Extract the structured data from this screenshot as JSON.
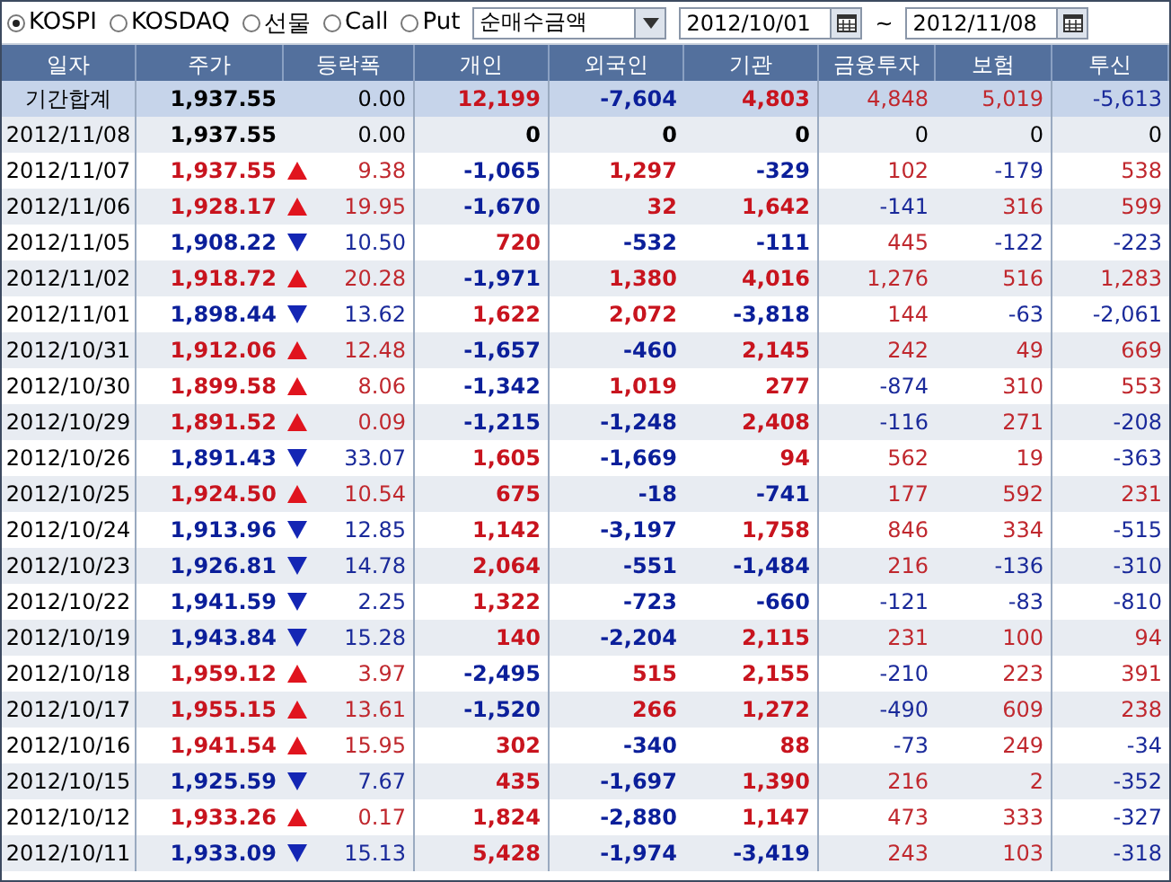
{
  "toolbar": {
    "markets": [
      {
        "label": "KOSPI",
        "selected": true
      },
      {
        "label": "KOSDAQ",
        "selected": false
      },
      {
        "label": "선물",
        "selected": false
      },
      {
        "label": "Call",
        "selected": false
      },
      {
        "label": "Put",
        "selected": false
      }
    ],
    "measure": {
      "value": "순매수금액"
    },
    "date_from": "2012/10/01",
    "range_separator": "~",
    "date_to": "2012/11/08"
  },
  "table": {
    "columns": [
      "일자",
      "주가",
      "등락폭",
      "개인",
      "외국인",
      "기관",
      "금융투자",
      "보험",
      "투신"
    ],
    "rows": [
      {
        "kind": "total",
        "rising": false,
        "falling": false,
        "cells": [
          {
            "text": "기간합계"
          },
          {
            "text": "1,937.55"
          },
          {
            "text": "0.00"
          },
          {
            "text": "12,199",
            "color": "#c8141e"
          },
          {
            "text": "-7,604",
            "color": "#0b1f9a"
          },
          {
            "text": "4,803",
            "color": "#c8141e"
          },
          {
            "text": "4,848",
            "color": "#c0282e"
          },
          {
            "text": "5,019",
            "color": "#c0282e"
          },
          {
            "text": "-5,613",
            "color": "#1a2a9a"
          }
        ]
      },
      {
        "kind": "day",
        "rising": false,
        "falling": false,
        "cells": [
          {
            "text": "2012/11/08"
          },
          {
            "text": "1,937.55"
          },
          {
            "text": "0.00"
          },
          {
            "text": "0"
          },
          {
            "text": "0"
          },
          {
            "text": "0"
          },
          {
            "text": "0"
          },
          {
            "text": "0"
          },
          {
            "text": "0"
          }
        ]
      },
      {
        "kind": "day",
        "rising": true,
        "falling": false,
        "cells": [
          {
            "text": "2012/11/07"
          },
          {
            "text": "1,937.55",
            "color": "#c8141e"
          },
          {
            "text": "9.38",
            "color": "#c0282e"
          },
          {
            "text": "-1,065",
            "color": "#0b1f9a"
          },
          {
            "text": "1,297",
            "color": "#c8141e"
          },
          {
            "text": "-329",
            "color": "#0b1f9a"
          },
          {
            "text": "102",
            "color": "#c0282e"
          },
          {
            "text": "-179",
            "color": "#1a2a9a"
          },
          {
            "text": "538",
            "color": "#c0282e"
          }
        ]
      },
      {
        "kind": "day",
        "rising": true,
        "falling": false,
        "cells": [
          {
            "text": "2012/11/06"
          },
          {
            "text": "1,928.17",
            "color": "#c8141e"
          },
          {
            "text": "19.95",
            "color": "#c0282e"
          },
          {
            "text": "-1,670",
            "color": "#0b1f9a"
          },
          {
            "text": "32",
            "color": "#c8141e"
          },
          {
            "text": "1,642",
            "color": "#c8141e"
          },
          {
            "text": "-141",
            "color": "#1a2a9a"
          },
          {
            "text": "316",
            "color": "#c0282e"
          },
          {
            "text": "599",
            "color": "#c0282e"
          }
        ]
      },
      {
        "kind": "day",
        "rising": false,
        "falling": true,
        "cells": [
          {
            "text": "2012/11/05"
          },
          {
            "text": "1,908.22",
            "color": "#0b1f9a"
          },
          {
            "text": "10.50",
            "color": "#1a2a9a"
          },
          {
            "text": "720",
            "color": "#c8141e"
          },
          {
            "text": "-532",
            "color": "#0b1f9a"
          },
          {
            "text": "-111",
            "color": "#0b1f9a"
          },
          {
            "text": "445",
            "color": "#c0282e"
          },
          {
            "text": "-122",
            "color": "#1a2a9a"
          },
          {
            "text": "-223",
            "color": "#1a2a9a"
          }
        ]
      },
      {
        "kind": "day",
        "rising": true,
        "falling": false,
        "cells": [
          {
            "text": "2012/11/02"
          },
          {
            "text": "1,918.72",
            "color": "#c8141e"
          },
          {
            "text": "20.28",
            "color": "#c0282e"
          },
          {
            "text": "-1,971",
            "color": "#0b1f9a"
          },
          {
            "text": "1,380",
            "color": "#c8141e"
          },
          {
            "text": "4,016",
            "color": "#c8141e"
          },
          {
            "text": "1,276",
            "color": "#c0282e"
          },
          {
            "text": "516",
            "color": "#c0282e"
          },
          {
            "text": "1,283",
            "color": "#c0282e"
          }
        ]
      },
      {
        "kind": "day",
        "rising": false,
        "falling": true,
        "cells": [
          {
            "text": "2012/11/01"
          },
          {
            "text": "1,898.44",
            "color": "#0b1f9a"
          },
          {
            "text": "13.62",
            "color": "#1a2a9a"
          },
          {
            "text": "1,622",
            "color": "#c8141e"
          },
          {
            "text": "2,072",
            "color": "#c8141e"
          },
          {
            "text": "-3,818",
            "color": "#0b1f9a"
          },
          {
            "text": "144",
            "color": "#c0282e"
          },
          {
            "text": "-63",
            "color": "#1a2a9a"
          },
          {
            "text": "-2,061",
            "color": "#1a2a9a"
          }
        ]
      },
      {
        "kind": "day",
        "rising": true,
        "falling": false,
        "cells": [
          {
            "text": "2012/10/31"
          },
          {
            "text": "1,912.06",
            "color": "#c8141e"
          },
          {
            "text": "12.48",
            "color": "#c0282e"
          },
          {
            "text": "-1,657",
            "color": "#0b1f9a"
          },
          {
            "text": "-460",
            "color": "#0b1f9a"
          },
          {
            "text": "2,145",
            "color": "#c8141e"
          },
          {
            "text": "242",
            "color": "#c0282e"
          },
          {
            "text": "49",
            "color": "#c0282e"
          },
          {
            "text": "669",
            "color": "#c0282e"
          }
        ]
      },
      {
        "kind": "day",
        "rising": true,
        "falling": false,
        "cells": [
          {
            "text": "2012/10/30"
          },
          {
            "text": "1,899.58",
            "color": "#c8141e"
          },
          {
            "text": "8.06",
            "color": "#c0282e"
          },
          {
            "text": "-1,342",
            "color": "#0b1f9a"
          },
          {
            "text": "1,019",
            "color": "#c8141e"
          },
          {
            "text": "277",
            "color": "#c8141e"
          },
          {
            "text": "-874",
            "color": "#1a2a9a"
          },
          {
            "text": "310",
            "color": "#c0282e"
          },
          {
            "text": "553",
            "color": "#c0282e"
          }
        ]
      },
      {
        "kind": "day",
        "rising": true,
        "falling": false,
        "cells": [
          {
            "text": "2012/10/29"
          },
          {
            "text": "1,891.52",
            "color": "#c8141e"
          },
          {
            "text": "0.09",
            "color": "#c0282e"
          },
          {
            "text": "-1,215",
            "color": "#0b1f9a"
          },
          {
            "text": "-1,248",
            "color": "#0b1f9a"
          },
          {
            "text": "2,408",
            "color": "#c8141e"
          },
          {
            "text": "-116",
            "color": "#1a2a9a"
          },
          {
            "text": "271",
            "color": "#c0282e"
          },
          {
            "text": "-208",
            "color": "#1a2a9a"
          }
        ]
      },
      {
        "kind": "day",
        "rising": false,
        "falling": true,
        "cells": [
          {
            "text": "2012/10/26"
          },
          {
            "text": "1,891.43",
            "color": "#0b1f9a"
          },
          {
            "text": "33.07",
            "color": "#1a2a9a"
          },
          {
            "text": "1,605",
            "color": "#c8141e"
          },
          {
            "text": "-1,669",
            "color": "#0b1f9a"
          },
          {
            "text": "94",
            "color": "#c8141e"
          },
          {
            "text": "562",
            "color": "#c0282e"
          },
          {
            "text": "19",
            "color": "#c0282e"
          },
          {
            "text": "-363",
            "color": "#1a2a9a"
          }
        ]
      },
      {
        "kind": "day",
        "rising": true,
        "falling": false,
        "cells": [
          {
            "text": "2012/10/25"
          },
          {
            "text": "1,924.50",
            "color": "#c8141e"
          },
          {
            "text": "10.54",
            "color": "#c0282e"
          },
          {
            "text": "675",
            "color": "#c8141e"
          },
          {
            "text": "-18",
            "color": "#0b1f9a"
          },
          {
            "text": "-741",
            "color": "#0b1f9a"
          },
          {
            "text": "177",
            "color": "#c0282e"
          },
          {
            "text": "592",
            "color": "#c0282e"
          },
          {
            "text": "231",
            "color": "#c0282e"
          }
        ]
      },
      {
        "kind": "day",
        "rising": false,
        "falling": true,
        "cells": [
          {
            "text": "2012/10/24"
          },
          {
            "text": "1,913.96",
            "color": "#0b1f9a"
          },
          {
            "text": "12.85",
            "color": "#1a2a9a"
          },
          {
            "text": "1,142",
            "color": "#c8141e"
          },
          {
            "text": "-3,197",
            "color": "#0b1f9a"
          },
          {
            "text": "1,758",
            "color": "#c8141e"
          },
          {
            "text": "846",
            "color": "#c0282e"
          },
          {
            "text": "334",
            "color": "#c0282e"
          },
          {
            "text": "-515",
            "color": "#1a2a9a"
          }
        ]
      },
      {
        "kind": "day",
        "rising": false,
        "falling": true,
        "cells": [
          {
            "text": "2012/10/23"
          },
          {
            "text": "1,926.81",
            "color": "#0b1f9a"
          },
          {
            "text": "14.78",
            "color": "#1a2a9a"
          },
          {
            "text": "2,064",
            "color": "#c8141e"
          },
          {
            "text": "-551",
            "color": "#0b1f9a"
          },
          {
            "text": "-1,484",
            "color": "#0b1f9a"
          },
          {
            "text": "216",
            "color": "#c0282e"
          },
          {
            "text": "-136",
            "color": "#1a2a9a"
          },
          {
            "text": "-310",
            "color": "#1a2a9a"
          }
        ]
      },
      {
        "kind": "day",
        "rising": false,
        "falling": true,
        "cells": [
          {
            "text": "2012/10/22"
          },
          {
            "text": "1,941.59",
            "color": "#0b1f9a"
          },
          {
            "text": "2.25",
            "color": "#1a2a9a"
          },
          {
            "text": "1,322",
            "color": "#c8141e"
          },
          {
            "text": "-723",
            "color": "#0b1f9a"
          },
          {
            "text": "-660",
            "color": "#0b1f9a"
          },
          {
            "text": "-121",
            "color": "#1a2a9a"
          },
          {
            "text": "-83",
            "color": "#1a2a9a"
          },
          {
            "text": "-810",
            "color": "#1a2a9a"
          }
        ]
      },
      {
        "kind": "day",
        "rising": false,
        "falling": true,
        "cells": [
          {
            "text": "2012/10/19"
          },
          {
            "text": "1,943.84",
            "color": "#0b1f9a"
          },
          {
            "text": "15.28",
            "color": "#1a2a9a"
          },
          {
            "text": "140",
            "color": "#c8141e"
          },
          {
            "text": "-2,204",
            "color": "#0b1f9a"
          },
          {
            "text": "2,115",
            "color": "#c8141e"
          },
          {
            "text": "231",
            "color": "#c0282e"
          },
          {
            "text": "100",
            "color": "#c0282e"
          },
          {
            "text": "94",
            "color": "#c0282e"
          }
        ]
      },
      {
        "kind": "day",
        "rising": true,
        "falling": false,
        "cells": [
          {
            "text": "2012/10/18"
          },
          {
            "text": "1,959.12",
            "color": "#c8141e"
          },
          {
            "text": "3.97",
            "color": "#c0282e"
          },
          {
            "text": "-2,495",
            "color": "#0b1f9a"
          },
          {
            "text": "515",
            "color": "#c8141e"
          },
          {
            "text": "2,155",
            "color": "#c8141e"
          },
          {
            "text": "-210",
            "color": "#1a2a9a"
          },
          {
            "text": "223",
            "color": "#c0282e"
          },
          {
            "text": "391",
            "color": "#c0282e"
          }
        ]
      },
      {
        "kind": "day",
        "rising": true,
        "falling": false,
        "cells": [
          {
            "text": "2012/10/17"
          },
          {
            "text": "1,955.15",
            "color": "#c8141e"
          },
          {
            "text": "13.61",
            "color": "#c0282e"
          },
          {
            "text": "-1,520",
            "color": "#0b1f9a"
          },
          {
            "text": "266",
            "color": "#c8141e"
          },
          {
            "text": "1,272",
            "color": "#c8141e"
          },
          {
            "text": "-490",
            "color": "#1a2a9a"
          },
          {
            "text": "609",
            "color": "#c0282e"
          },
          {
            "text": "238",
            "color": "#c0282e"
          }
        ]
      },
      {
        "kind": "day",
        "rising": true,
        "falling": false,
        "cells": [
          {
            "text": "2012/10/16"
          },
          {
            "text": "1,941.54",
            "color": "#c8141e"
          },
          {
            "text": "15.95",
            "color": "#c0282e"
          },
          {
            "text": "302",
            "color": "#c8141e"
          },
          {
            "text": "-340",
            "color": "#0b1f9a"
          },
          {
            "text": "88",
            "color": "#c8141e"
          },
          {
            "text": "-73",
            "color": "#1a2a9a"
          },
          {
            "text": "249",
            "color": "#c0282e"
          },
          {
            "text": "-34",
            "color": "#1a2a9a"
          }
        ]
      },
      {
        "kind": "day",
        "rising": false,
        "falling": true,
        "cells": [
          {
            "text": "2012/10/15"
          },
          {
            "text": "1,925.59",
            "color": "#0b1f9a"
          },
          {
            "text": "7.67",
            "color": "#1a2a9a"
          },
          {
            "text": "435",
            "color": "#c8141e"
          },
          {
            "text": "-1,697",
            "color": "#0b1f9a"
          },
          {
            "text": "1,390",
            "color": "#c8141e"
          },
          {
            "text": "216",
            "color": "#c0282e"
          },
          {
            "text": "2",
            "color": "#c0282e"
          },
          {
            "text": "-352",
            "color": "#1a2a9a"
          }
        ]
      },
      {
        "kind": "day",
        "rising": true,
        "falling": false,
        "cells": [
          {
            "text": "2012/10/12"
          },
          {
            "text": "1,933.26",
            "color": "#c8141e"
          },
          {
            "text": "0.17",
            "color": "#c0282e"
          },
          {
            "text": "1,824",
            "color": "#c8141e"
          },
          {
            "text": "-2,880",
            "color": "#0b1f9a"
          },
          {
            "text": "1,147",
            "color": "#c8141e"
          },
          {
            "text": "473",
            "color": "#c0282e"
          },
          {
            "text": "333",
            "color": "#c0282e"
          },
          {
            "text": "-327",
            "color": "#1a2a9a"
          }
        ]
      },
      {
        "kind": "day",
        "rising": false,
        "falling": true,
        "cells": [
          {
            "text": "2012/10/11"
          },
          {
            "text": "1,933.09",
            "color": "#0b1f9a"
          },
          {
            "text": "15.13",
            "color": "#1a2a9a"
          },
          {
            "text": "5,428",
            "color": "#c8141e"
          },
          {
            "text": "-1,974",
            "color": "#0b1f9a"
          },
          {
            "text": "-3,419",
            "color": "#0b1f9a"
          },
          {
            "text": "243",
            "color": "#c0282e"
          },
          {
            "text": "103",
            "color": "#c0282e"
          },
          {
            "text": "-318",
            "color": "#1a2a9a"
          }
        ]
      }
    ]
  }
}
